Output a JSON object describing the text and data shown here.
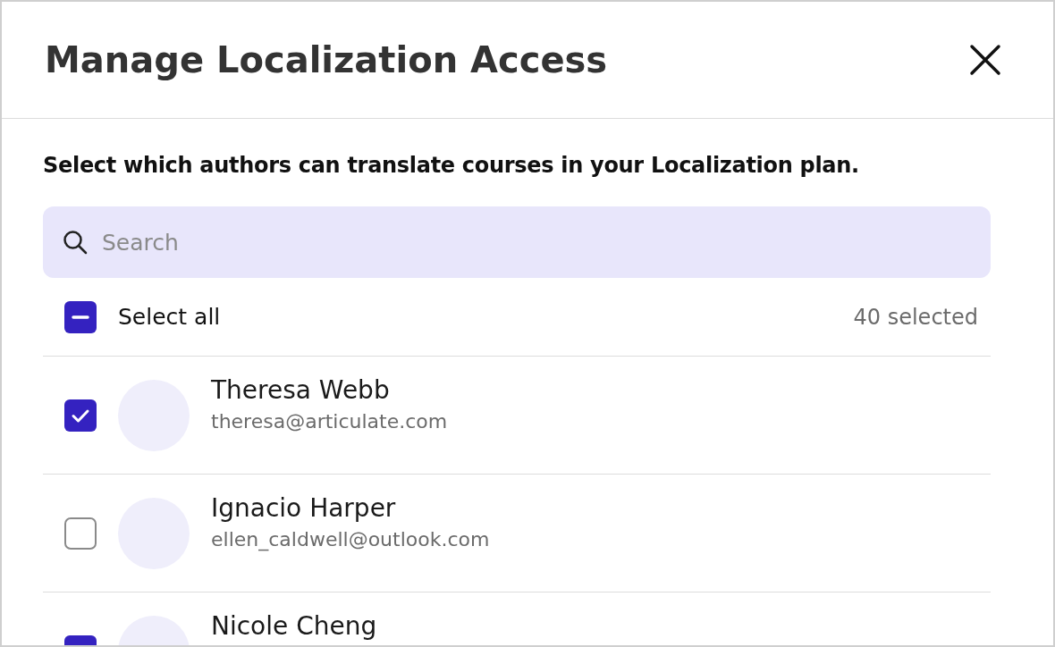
{
  "dialog": {
    "title": "Manage Localization Access"
  },
  "instructions": "Select which authors can translate courses in your Localization plan.",
  "search": {
    "placeholder": "Search"
  },
  "select_all": {
    "label": "Select all",
    "indeterminate": true,
    "count": "40 selected"
  },
  "authors": [
    {
      "name": "Theresa Webb",
      "email": "theresa@articulate.com",
      "checked": true
    },
    {
      "name": "Ignacio Harper",
      "email": "ellen_caldwell@outlook.com",
      "checked": false
    },
    {
      "name": "Nicole Cheng",
      "checked": true
    }
  ]
}
